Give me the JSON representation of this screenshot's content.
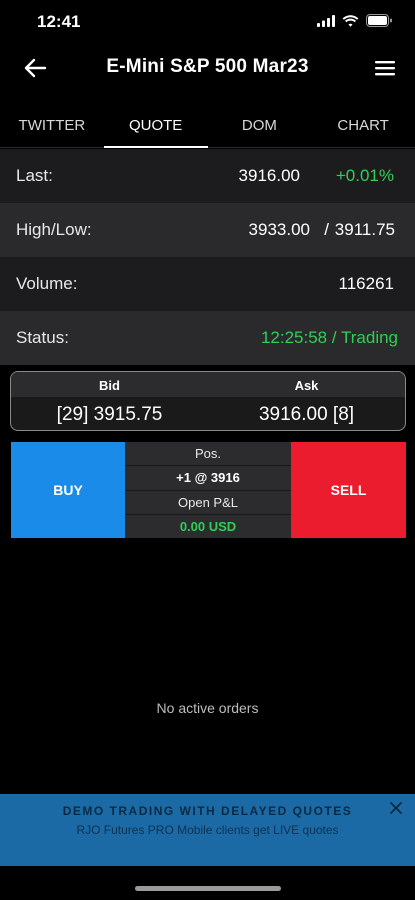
{
  "status_bar": {
    "time": "12:41"
  },
  "header": {
    "title": "E-Mini S&P 500 Mar23"
  },
  "tabs": [
    {
      "label": "TWITTER",
      "active": false
    },
    {
      "label": "QUOTE",
      "active": true
    },
    {
      "label": "DOM",
      "active": false
    },
    {
      "label": "CHART",
      "active": false
    }
  ],
  "quote": {
    "last_label": "Last:",
    "last_value": "3916.00",
    "last_change": "+0.01%",
    "highlow_label": "High/Low:",
    "high": "3933.00",
    "highlow_sep": "/",
    "low": "3911.75",
    "volume_label": "Volume:",
    "volume": "116261",
    "status_label": "Status:",
    "status_value": "12:25:58 / Trading"
  },
  "bidask": {
    "bid_label": "Bid",
    "ask_label": "Ask",
    "bid_value": "[29] 3915.75",
    "ask_value": "3916.00 [8]"
  },
  "trade": {
    "buy_label": "BUY",
    "sell_label": "SELL",
    "pos_label": "Pos.",
    "pos_value": "+1 @ 3916",
    "pnl_label": "Open P&L",
    "pnl_value": "0.00 USD"
  },
  "orders": {
    "empty_text": "No active orders"
  },
  "banner": {
    "title": "DEMO TRADING WITH DELAYED QUOTES",
    "subtitle": "RJO Futures PRO Mobile clients get LIVE quotes"
  },
  "colors": {
    "positive": "#2fcf55",
    "buy": "#1a8be8",
    "sell": "#eb1c2d",
    "banner": "#1b6aa5"
  }
}
